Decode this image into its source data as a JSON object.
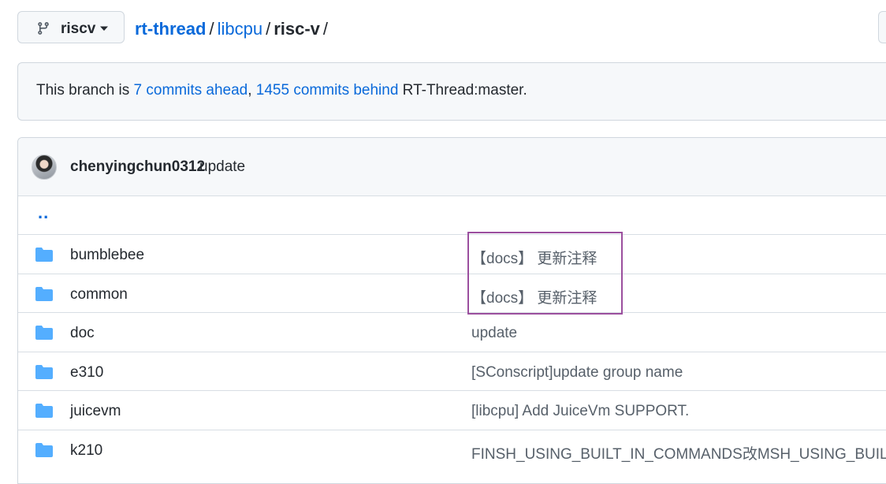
{
  "path_bar": {
    "branch": "riscv",
    "breadcrumb": {
      "root": "rt-thread",
      "mid": "libcpu",
      "current": "risc-v",
      "sep": "/"
    }
  },
  "branch_status": {
    "prefix": "This branch is ",
    "ahead": "7 commits ahead",
    "comma": ", ",
    "behind": "1455 commits behind",
    "suffix": " RT-Thread:master."
  },
  "latest_commit": {
    "author": "chenyingchun0312",
    "message": "update"
  },
  "parent_dir": "..",
  "files": [
    {
      "name": "bumblebee",
      "commit": "【docs】 更新注释"
    },
    {
      "name": "common",
      "commit": "【docs】 更新注释"
    },
    {
      "name": "doc",
      "commit": "update"
    },
    {
      "name": "e310",
      "commit": "[SConscript]update group name"
    },
    {
      "name": "juicevm",
      "commit": "[libcpu] Add JuiceVm SUPPORT."
    },
    {
      "name": "k210",
      "commit": "FINSH_USING_BUILT_IN_COMMANDS改MSH_USING_BUILT_IN_C"
    }
  ],
  "colors": {
    "link": "#0969da",
    "folder": "#54aeff",
    "highlight": "#9b4f9e"
  },
  "icons": {
    "branch": "git-branch-icon",
    "caret": "caret-down-icon",
    "folder": "folder-icon"
  }
}
